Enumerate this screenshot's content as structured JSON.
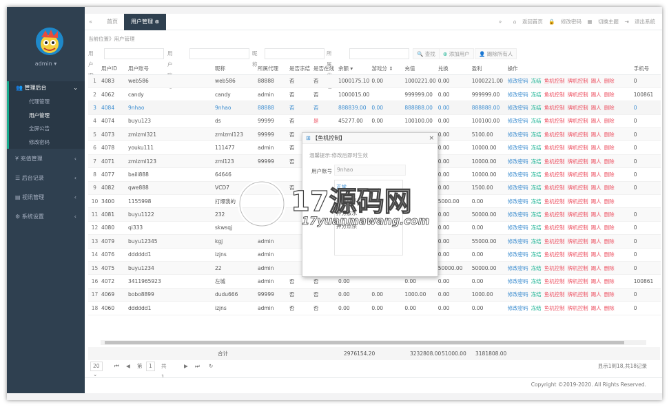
{
  "sidebar": {
    "user": "admin ▾",
    "active_group": "管理后台",
    "active_items": [
      "代理管理",
      "用户管理",
      "全屏公告",
      "修改密码"
    ],
    "groups": [
      "充值管理",
      "后台记录",
      "视讯管理",
      "系统设置"
    ]
  },
  "topbar": {
    "tabs": [
      "首页",
      "用户管理"
    ],
    "links": [
      "返回首页",
      "修改密码",
      "切换主题",
      "退出系统"
    ]
  },
  "breadcrumb": "当前位置》用户管理",
  "search": {
    "labels": [
      "用户ID",
      "用户账号",
      "昵称",
      "所属代理"
    ],
    "buttons": [
      "查找",
      "添加用户",
      "踢除所有人"
    ]
  },
  "table": {
    "headers": [
      "",
      "用户ID",
      "用户账号",
      "昵称",
      "所属代理",
      "是否冻结",
      "是否在线",
      "余额 ▾",
      "游戏分 ⇕",
      "充值",
      "兑换",
      "盈利",
      "操作",
      "手机号"
    ],
    "actions": [
      "修改密码",
      "冻结",
      "鱼机控制",
      "牌机控制",
      "踢人",
      "删除"
    ],
    "rows": [
      [
        "1",
        "4083",
        "web586",
        "web586",
        "88888",
        "否",
        "否",
        "1000175.10",
        "0.00",
        "1000221.00",
        "0.00",
        "1000221.00",
        "0"
      ],
      [
        "2",
        "4062",
        "candy",
        "candy",
        "admin",
        "否",
        "否",
        "1000015.00",
        "",
        "999999.00",
        "0.00",
        "999999.00",
        "100861"
      ],
      [
        "3",
        "4084",
        "9nhao",
        "9nhao",
        "88888",
        "否",
        "否",
        "888839.00",
        "0.00",
        "888888.00",
        "0.00",
        "888888.00",
        "0"
      ],
      [
        "4",
        "4074",
        "buyu123",
        "ds",
        "99999",
        "否",
        "是",
        "45277.00",
        "0.00",
        "100100.00",
        "0.00",
        "100100.00",
        "0"
      ],
      [
        "5",
        "4073",
        "zmlzml321",
        "zmlzml123",
        "99999",
        "否",
        "",
        "",
        "",
        "",
        "0.00",
        "5100.00",
        "0"
      ],
      [
        "6",
        "4078",
        "youku111",
        "111477",
        "admin",
        "否",
        "",
        "",
        "",
        "",
        "0.00",
        "10000.00",
        "0"
      ],
      [
        "7",
        "4071",
        "zmlzml123",
        "zml123",
        "99999",
        "否",
        "",
        "",
        "",
        "",
        "0.00",
        "10000.00",
        "0"
      ],
      [
        "8",
        "4077",
        "baili888",
        "64646",
        "",
        "",
        "",
        "",
        "",
        "",
        "0.00",
        "10000.00",
        "0"
      ],
      [
        "9",
        "4082",
        "qwe888",
        "VCD7",
        "",
        "否",
        "",
        "",
        "",
        "",
        "0.00",
        "1500.00",
        "0"
      ],
      [
        "10",
        "3400",
        "1155998",
        "打爆我的",
        "",
        "",
        "",
        "",
        "",
        "",
        "5000.00",
        "0.00",
        ""
      ],
      [
        "11",
        "4081",
        "buyu1122",
        "232",
        "",
        "",
        "",
        "",
        "",
        "",
        "0.00",
        "50000.00",
        "0"
      ],
      [
        "12",
        "4080",
        "qi333",
        "skwsqj",
        "",
        "",
        "",
        "",
        "",
        "",
        "0.00",
        "0.00",
        "0"
      ],
      [
        "13",
        "4079",
        "buyu12345",
        "kgj",
        "admin",
        "",
        "",
        "",
        "",
        "",
        "0.00",
        "55000.00",
        "0"
      ],
      [
        "14",
        "4076",
        "dddddd1",
        "izjns",
        "admin",
        "",
        "",
        "",
        "",
        "",
        "0.00",
        "0.00",
        "0"
      ],
      [
        "15",
        "4075",
        "buyu1234",
        "22",
        "admin",
        "",
        "",
        "",
        "",
        "",
        "50000.00",
        "50000.00",
        "0"
      ],
      [
        "16",
        "4072",
        "3411965923",
        "左城",
        "admin",
        "否",
        "否",
        "0.00",
        "",
        "0.00",
        "0.00",
        "0.00",
        "100861"
      ],
      [
        "17",
        "4069",
        "bobo8899",
        "dudu666",
        "99999",
        "否",
        "否",
        "0.00",
        "0.00",
        "1000.00",
        "0.00",
        "1000.00",
        "0"
      ],
      [
        "18",
        "4060",
        "dddddd1",
        "izjns",
        "admin",
        "否",
        "否",
        "0.00",
        "0.00",
        "0.00",
        "0.00",
        "0.00",
        "0"
      ]
    ]
  },
  "totals": {
    "label": "合计",
    "balance": "2976154.20",
    "recharge": "3232808.00",
    "exchange": "51000.00",
    "profit": "3181808.00"
  },
  "pager": {
    "size": "20 ⌄",
    "first": "⏮",
    "prev": "◀",
    "page_prefix": "第",
    "page": "1",
    "page_suffix": "共1页",
    "next": "▶",
    "last": "⏭",
    "refresh": "↻",
    "info": "显示1到18,共18记录"
  },
  "copyright": "Copyright ©2019-2020. All Rights Reserved.",
  "modal": {
    "title": "【鱼机控制】",
    "close": "×",
    "tip": "温馨提示:修改后即时生效",
    "label": "用户账号",
    "value": "9nhao",
    "options": [
      "正常",
      "赢分放水",
      "押分放水",
      "押分点杀"
    ]
  },
  "watermark": {
    "text": "17源码网",
    "url": "17yuanmawang.com"
  }
}
